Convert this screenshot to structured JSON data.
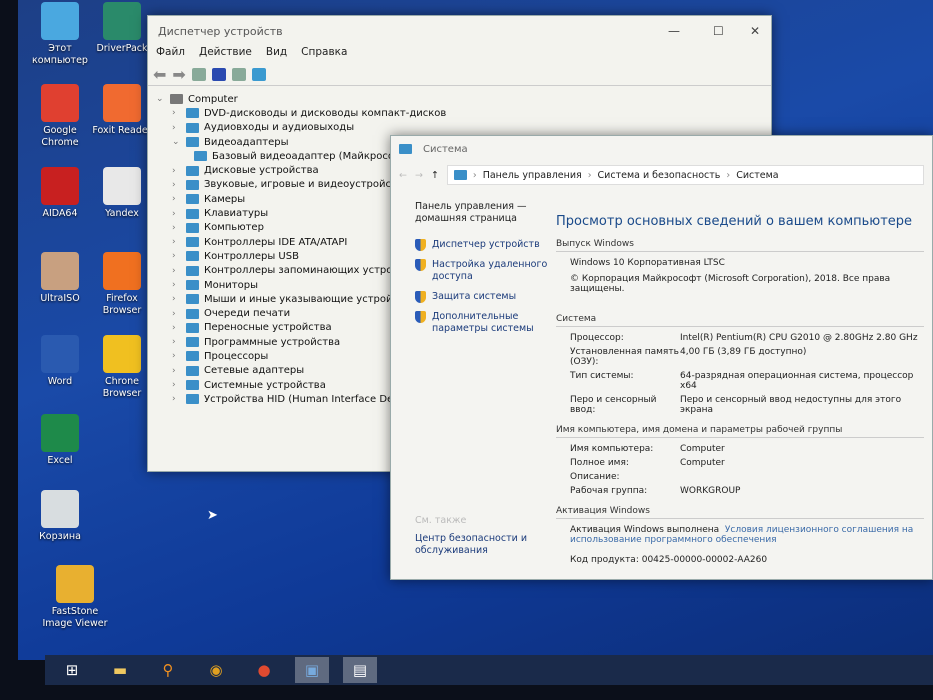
{
  "desktop": {
    "icons": [
      {
        "label": "Этот компьютер",
        "color": "#4aa8e0"
      },
      {
        "label": "DriverPack",
        "color": "#2a8a6a"
      },
      {
        "label": "Google Chrome",
        "color": "#e04030"
      },
      {
        "label": "Foxit Reader",
        "color": "#f06a30"
      },
      {
        "label": "AIDA64",
        "color": "#c82020"
      },
      {
        "label": "Yandex",
        "color": "#e8e8e8"
      },
      {
        "label": "UltraISO",
        "color": "#c8a080"
      },
      {
        "label": "Firefox Browser",
        "color": "#f07020"
      },
      {
        "label": "Word",
        "color": "#2a5ab0"
      },
      {
        "label": "Chrone Browser",
        "color": "#f0c020"
      },
      {
        "label": "Excel",
        "color": "#1e8a4a"
      },
      {
        "label": "Корзина",
        "color": "#d8dde0"
      },
      {
        "label": "FastStone Image Viewer",
        "color": "#e8b030"
      }
    ]
  },
  "device_manager": {
    "title": "Диспетчер устройств",
    "menu": [
      "Файл",
      "Действие",
      "Вид",
      "Справка"
    ],
    "root": "Computer",
    "items": [
      "DVD-дисководы и дисководы компакт-дисков",
      "Аудиовходы и аудиовыходы",
      "Видеоадаптеры",
      "Базовый видеоадаптер (Майкрософт)",
      "Дисковые устройства",
      "Звуковые, игровые и видеоустройства",
      "Камеры",
      "Клавиатуры",
      "Компьютер",
      "Контроллеры IDE ATA/ATAPI",
      "Контроллеры USB",
      "Контроллеры запоминающих устройств",
      "Мониторы",
      "Мыши и иные указывающие устройства",
      "Очереди печати",
      "Переносные устройства",
      "Программные устройства",
      "Процессоры",
      "Сетевые адаптеры",
      "Системные устройства",
      "Устройства HID (Human Interface Devices)"
    ]
  },
  "system": {
    "title": "Система",
    "breadcrumbs": [
      "Панель управления",
      "Система и безопасность",
      "Система"
    ],
    "left": {
      "home": "Панель управления — домашняя страница",
      "links": [
        "Диспетчер устройств",
        "Настройка удаленного доступа",
        "Защита системы",
        "Дополнительные параметры системы"
      ],
      "see_also": "См. также",
      "security": "Центр безопасности и обслуживания"
    },
    "heading": "Просмотр основных сведений о вашем компьютере",
    "edition_section": "Выпуск Windows",
    "edition": "Windows 10 Корпоративная LTSC",
    "copyright": "© Корпорация Майкрософт (Microsoft Corporation), 2018. Все права защищены.",
    "system_section": "Система",
    "system_rows": [
      [
        "Процессор:",
        "Intel(R) Pentium(R) CPU G2010 @ 2.80GHz   2.80 GHz"
      ],
      [
        "Установленная память (ОЗУ):",
        "4,00 ГБ (3,89 ГБ доступно)"
      ],
      [
        "Тип системы:",
        "64-разрядная операционная система, процессор x64"
      ],
      [
        "Перо и сенсорный ввод:",
        "Перо и сенсорный ввод недоступны для этого экрана"
      ]
    ],
    "name_section": "Имя компьютера, имя домена и параметры рабочей группы",
    "name_rows": [
      [
        "Имя компьютера:",
        "Computer"
      ],
      [
        "Полное имя:",
        "Computer"
      ],
      [
        "Описание:",
        ""
      ],
      [
        "Рабочая группа:",
        "WORKGROUP"
      ]
    ],
    "activation_section": "Активация Windows",
    "activation_status": "Активация Windows выполнена",
    "license_link": "Условия лицензионного соглашения на использование программного обеспечения",
    "product_key": "Код продукта: 00425-00000-00002-AA260"
  }
}
